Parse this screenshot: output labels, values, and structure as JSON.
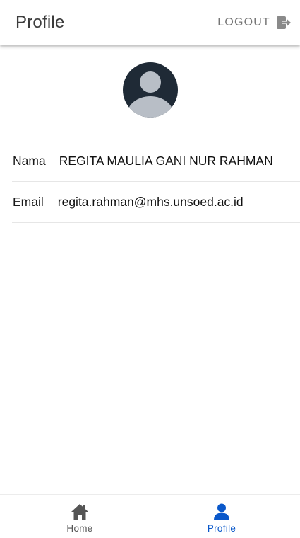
{
  "header": {
    "title": "Profile",
    "logout_label": "LOGOUT",
    "logout_icon": "logout-icon"
  },
  "profile": {
    "avatar_icon": "default-avatar-icon",
    "fields": [
      {
        "label": "Nama",
        "value": "REGITA MAULIA GANI NUR RAHMAN"
      },
      {
        "label": "Email",
        "value": "regita.rahman@mhs.unsoed.ac.id"
      }
    ]
  },
  "bottom_nav": {
    "items": [
      {
        "label": "Home",
        "icon": "home-icon",
        "active": false
      },
      {
        "label": "Profile",
        "icon": "person-icon",
        "active": true
      }
    ]
  },
  "colors": {
    "active": "#0a58ca",
    "inactive": "#555555",
    "avatar_bg": "#1f2a36",
    "avatar_figure": "#b8bec6"
  }
}
